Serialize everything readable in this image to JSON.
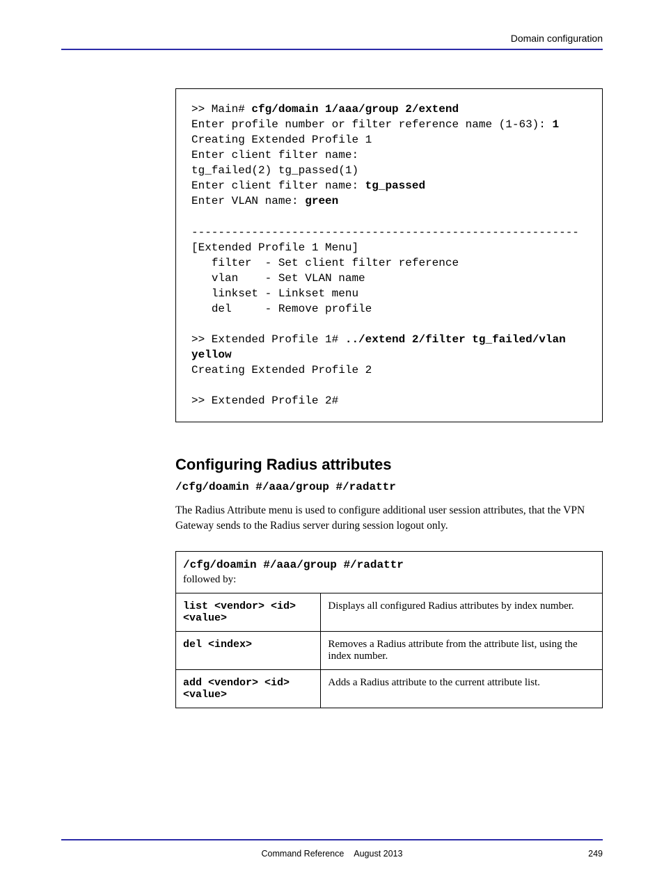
{
  "header": {
    "right": "Domain configuration"
  },
  "terminal": {
    "l1_prompt": ">> Main# ",
    "l1_cmd": "cfg/domain 1/aaa/group 2/extend",
    "l2": "Enter profile number or filter reference name (1-63): ",
    "l2_in": "1",
    "l3": "Creating Extended Profile 1",
    "l4": "Enter client filter name:",
    "l5": "tg_failed(2) tg_passed(1)",
    "l6": "Enter client filter name: ",
    "l6_in": "tg_passed",
    "l7": "Enter VLAN name: ",
    "l7_in": "green",
    "hr": "----------------------------------------------------------",
    "m1": "[Extended Profile 1 Menu]",
    "m2": "   filter  - Set client filter reference",
    "m3": "   vlan    - Set VLAN name",
    "m4": "   linkset - Linkset menu",
    "m5": "   del     - Remove profile",
    "p2_prompt": ">> Extended Profile 1# ",
    "p2_cmd": "../extend 2/filter tg_failed/vlan yellow",
    "l8": "Creating Extended Profile 2",
    "p3": ">> Extended Profile 2#"
  },
  "section": {
    "heading": "Configuring Radius attributes",
    "subpath": "/cfg/doamin #/aaa/group #/radattr",
    "body": "The Radius Attribute menu is used to configure additional user session attributes, that the VPN Gateway sends to the Radius server during session logout only."
  },
  "table": {
    "header": "/cfg/doamin #/aaa/group #/radattr",
    "sub": "followed by:",
    "rows": [
      {
        "cmd": "list <vendor> <id> <value>",
        "desc": "Displays all configured Radius attributes by index number."
      },
      {
        "cmd": "del <index>",
        "desc": "Removes a Radius attribute from the attribute list, using the index number."
      },
      {
        "cmd": "add <vendor> <id> <value>",
        "desc": "Adds a Radius attribute to the current attribute list."
      }
    ]
  },
  "footer": {
    "center": "Command Reference",
    "month_year": "August 2013",
    "page": "249"
  }
}
